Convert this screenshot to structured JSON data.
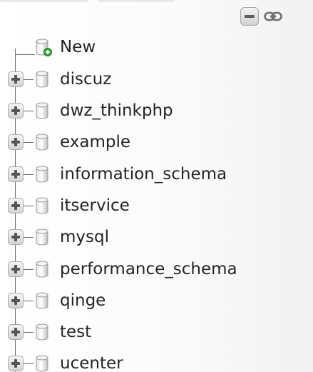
{
  "tree": {
    "new_item": {
      "label": "New",
      "icon": "database-new-icon"
    },
    "databases": [
      {
        "label": "discuz"
      },
      {
        "label": "dwz_thinkphp"
      },
      {
        "label": "example"
      },
      {
        "label": "information_schema"
      },
      {
        "label": "itservice"
      },
      {
        "label": "mysql"
      },
      {
        "label": "performance_schema"
      },
      {
        "label": "qinge"
      },
      {
        "label": "test"
      },
      {
        "label": "ucenter"
      }
    ]
  },
  "controls": {
    "collapse_icon": "collapse-all-icon",
    "link_icon": "link-with-main-panel-icon"
  },
  "colors": {
    "accent_green": "#3aa53a",
    "line": "#6d6d6d",
    "text": "#242424"
  }
}
